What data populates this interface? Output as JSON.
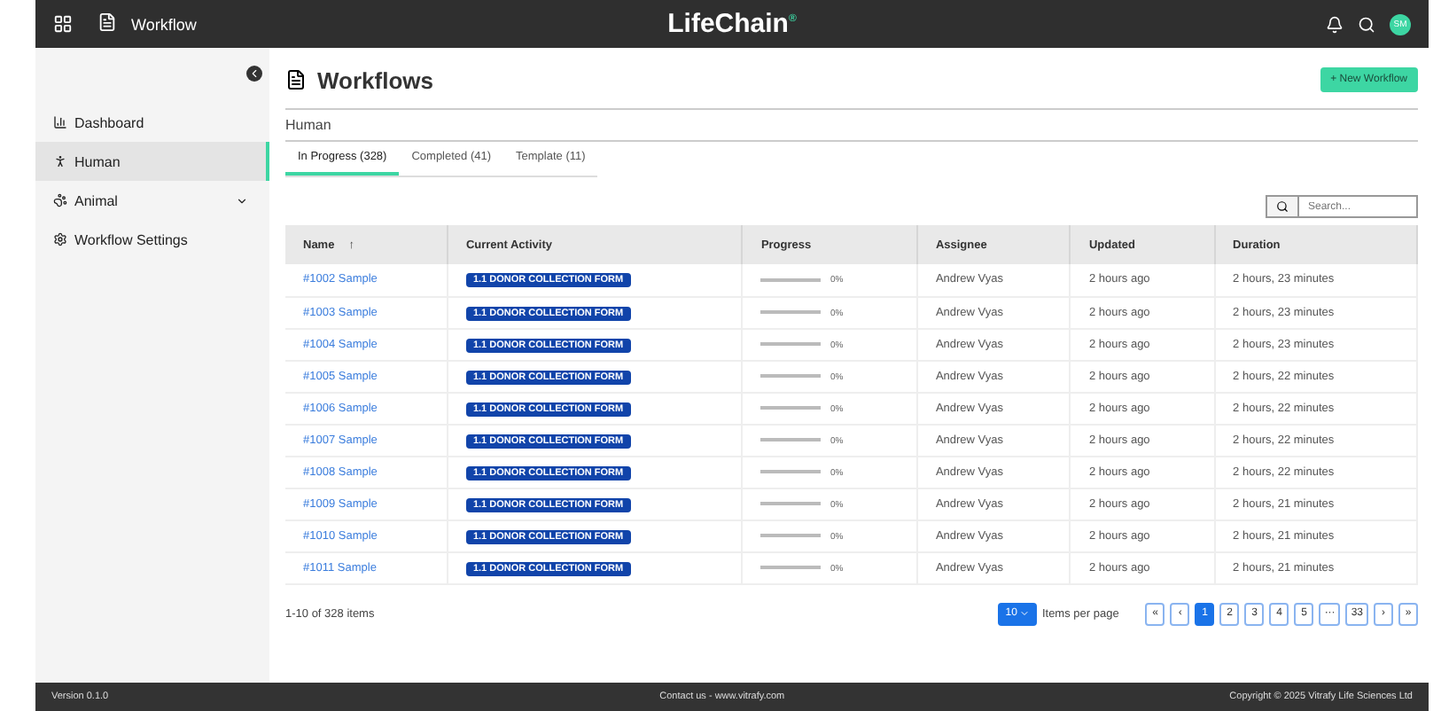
{
  "topbar": {
    "app_name": "Workflow",
    "brand": "LifeChain",
    "brand_mark": "®",
    "avatar": "SM"
  },
  "sidebar": {
    "items": [
      {
        "label": "Dashboard",
        "kind": "chart",
        "selected": false,
        "expandable": false
      },
      {
        "label": "Human",
        "kind": "person",
        "selected": true,
        "expandable": false
      },
      {
        "label": "Animal",
        "kind": "paw",
        "selected": false,
        "expandable": true
      },
      {
        "label": "Workflow Settings",
        "kind": "gear",
        "selected": false,
        "expandable": false
      }
    ]
  },
  "page": {
    "title": "Workflows",
    "new_button": "+ New Workflow",
    "section": "Human"
  },
  "tabs": [
    {
      "label": "In Progress (328)",
      "selected": true
    },
    {
      "label": "Completed (41)",
      "selected": false
    },
    {
      "label": "Template (11)",
      "selected": false
    }
  ],
  "search": {
    "placeholder": "Search..."
  },
  "table": {
    "columns": [
      {
        "label": "Name",
        "sort": "↑"
      },
      {
        "label": "Current Activity"
      },
      {
        "label": "Progress"
      },
      {
        "label": "Assignee"
      },
      {
        "label": "Updated"
      },
      {
        "label": "Duration"
      }
    ],
    "rows": [
      {
        "name": "#1002 Sample",
        "activity": "1.1 DONOR COLLECTION FORM",
        "level": 0,
        "reading": "0%",
        "assignee": "Andrew Vyas",
        "updated": "2 hours ago",
        "duration": "2 hours, 23 minutes"
      },
      {
        "name": "#1003 Sample",
        "activity": "1.1 DONOR COLLECTION FORM",
        "level": 0,
        "reading": "0%",
        "assignee": "Andrew Vyas",
        "updated": "2 hours ago",
        "duration": "2 hours, 23 minutes"
      },
      {
        "name": "#1004 Sample",
        "activity": "1.1 DONOR COLLECTION FORM",
        "level": 0,
        "reading": "0%",
        "assignee": "Andrew Vyas",
        "updated": "2 hours ago",
        "duration": "2 hours, 23 minutes"
      },
      {
        "name": "#1005 Sample",
        "activity": "1.1 DONOR COLLECTION FORM",
        "level": 0,
        "reading": "0%",
        "assignee": "Andrew Vyas",
        "updated": "2 hours ago",
        "duration": "2 hours, 22 minutes"
      },
      {
        "name": "#1006 Sample",
        "activity": "1.1 DONOR COLLECTION FORM",
        "level": 0,
        "reading": "0%",
        "assignee": "Andrew Vyas",
        "updated": "2 hours ago",
        "duration": "2 hours, 22 minutes"
      },
      {
        "name": "#1007 Sample",
        "activity": "1.1 DONOR COLLECTION FORM",
        "level": 0,
        "reading": "0%",
        "assignee": "Andrew Vyas",
        "updated": "2 hours ago",
        "duration": "2 hours, 22 minutes"
      },
      {
        "name": "#1008 Sample",
        "activity": "1.1 DONOR COLLECTION FORM",
        "level": 0,
        "reading": "0%",
        "assignee": "Andrew Vyas",
        "updated": "2 hours ago",
        "duration": "2 hours, 22 minutes"
      },
      {
        "name": "#1009 Sample",
        "activity": "1.1 DONOR COLLECTION FORM",
        "level": 0,
        "reading": "0%",
        "assignee": "Andrew Vyas",
        "updated": "2 hours ago",
        "duration": "2 hours, 21 minutes"
      },
      {
        "name": "#1010 Sample",
        "activity": "1.1 DONOR COLLECTION FORM",
        "level": 0,
        "reading": "0%",
        "assignee": "Andrew Vyas",
        "updated": "2 hours ago",
        "duration": "2 hours, 21 minutes"
      },
      {
        "name": "#1011 Sample",
        "activity": "1.1 DONOR COLLECTION FORM",
        "level": 0,
        "reading": "0%",
        "assignee": "Andrew Vyas",
        "updated": "2 hours ago",
        "duration": "2 hours, 21 minutes"
      }
    ]
  },
  "pagination": {
    "summary": "1-10 of 328 items",
    "page_size": "10",
    "page_size_label": "Items per page",
    "first": "«",
    "prev": "‹",
    "pages": [
      {
        "label": "1",
        "selected": true
      },
      {
        "label": "2",
        "selected": false
      },
      {
        "label": "3",
        "selected": false
      },
      {
        "label": "4",
        "selected": false
      },
      {
        "label": "5",
        "selected": false
      },
      {
        "label": "···",
        "selected": false
      },
      {
        "label": "33",
        "selected": false
      }
    ],
    "next": "›",
    "last": "»"
  },
  "footer": {
    "version": "Version 0.1.0",
    "contact": "Contact us  -  www.vitrafy.com",
    "copyright": "Copyright © 2025 Vitrafy Life Sciences Ltd"
  }
}
